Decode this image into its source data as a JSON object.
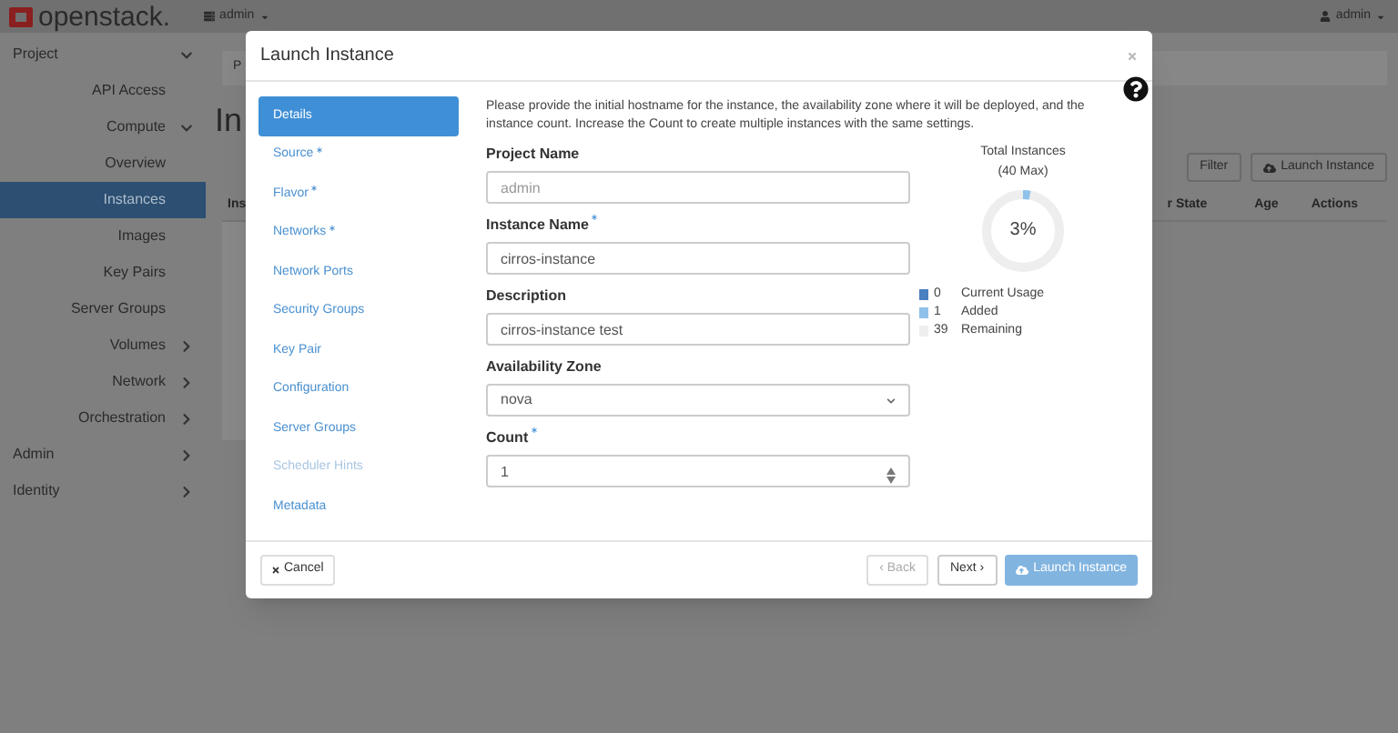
{
  "topbar": {
    "logo": "openstack.",
    "project_menu": "admin",
    "user_menu": "admin"
  },
  "sidebar": {
    "items": [
      {
        "label": "Project",
        "expanded": true,
        "selected": false,
        "children": [
          {
            "label": "API Access",
            "selected": false
          },
          {
            "label": "Compute",
            "expanded": true,
            "selected": false,
            "children": [
              {
                "label": "Overview",
                "selected": false
              },
              {
                "label": "Instances",
                "selected": true
              },
              {
                "label": "Images",
                "selected": false
              },
              {
                "label": "Key Pairs",
                "selected": false
              },
              {
                "label": "Server Groups",
                "selected": false
              }
            ]
          },
          {
            "label": "Volumes",
            "expanded": false,
            "selected": false
          },
          {
            "label": "Network",
            "expanded": false,
            "selected": false
          },
          {
            "label": "Orchestration",
            "expanded": false,
            "selected": false
          }
        ]
      },
      {
        "label": "Admin",
        "expanded": false,
        "selected": false
      },
      {
        "label": "Identity",
        "expanded": false,
        "selected": false
      }
    ]
  },
  "page": {
    "breadcrumb": "P",
    "title": "In",
    "filter_button": "Filter",
    "launch_button": "Launch Instance",
    "table": {
      "columns": [
        "Ins",
        "r State",
        "Age",
        "Actions"
      ]
    }
  },
  "modal": {
    "title": "Launch Instance",
    "steps": [
      {
        "label": "Details",
        "required": false,
        "selected": true,
        "disabled": false
      },
      {
        "label": "Source",
        "required": true,
        "selected": false,
        "disabled": false
      },
      {
        "label": "Flavor",
        "required": true,
        "selected": false,
        "disabled": false
      },
      {
        "label": "Networks",
        "required": true,
        "selected": false,
        "disabled": false
      },
      {
        "label": "Network Ports",
        "required": false,
        "selected": false,
        "disabled": false
      },
      {
        "label": "Security Groups",
        "required": false,
        "selected": false,
        "disabled": false
      },
      {
        "label": "Key Pair",
        "required": false,
        "selected": false,
        "disabled": false
      },
      {
        "label": "Configuration",
        "required": false,
        "selected": false,
        "disabled": false
      },
      {
        "label": "Server Groups",
        "required": false,
        "selected": false,
        "disabled": false
      },
      {
        "label": "Scheduler Hints",
        "required": false,
        "selected": false,
        "disabled": true
      },
      {
        "label": "Metadata",
        "required": false,
        "selected": false,
        "disabled": false
      }
    ],
    "intro": "Please provide the initial hostname for the instance, the availability zone where it will be deployed, and the instance count. Increase the Count to create multiple instances with the same settings.",
    "fields": [
      {
        "kind": "text",
        "label": "Project Name",
        "required": false,
        "readonly": true,
        "value": "admin"
      },
      {
        "kind": "text",
        "label": "Instance Name",
        "required": true,
        "readonly": false,
        "value": "cirros-instance"
      },
      {
        "kind": "text",
        "label": "Description",
        "required": false,
        "readonly": false,
        "value": "cirros-instance test"
      },
      {
        "kind": "select",
        "label": "Availability Zone",
        "required": false,
        "readonly": false,
        "value": "nova"
      },
      {
        "kind": "number",
        "label": "Count",
        "required": true,
        "readonly": false,
        "value": "1"
      }
    ],
    "quota": {
      "title": "Total Instances",
      "subtitle": "(40 Max)",
      "percent": "3%",
      "level": 0.03,
      "legend": [
        {
          "value": "0",
          "label": "Current Usage",
          "color": "#4a7fc1"
        },
        {
          "value": "1",
          "label": "Added",
          "color": "#8fc1ea"
        },
        {
          "value": "39",
          "label": "Remaining",
          "color": "#eeeeee"
        }
      ]
    },
    "footer": {
      "cancel": "Cancel",
      "back": {
        "label": "‹ Back",
        "disabled": true
      },
      "next": "Next ›",
      "launch": {
        "label": "Launch Instance",
        "disabled": true
      }
    }
  }
}
